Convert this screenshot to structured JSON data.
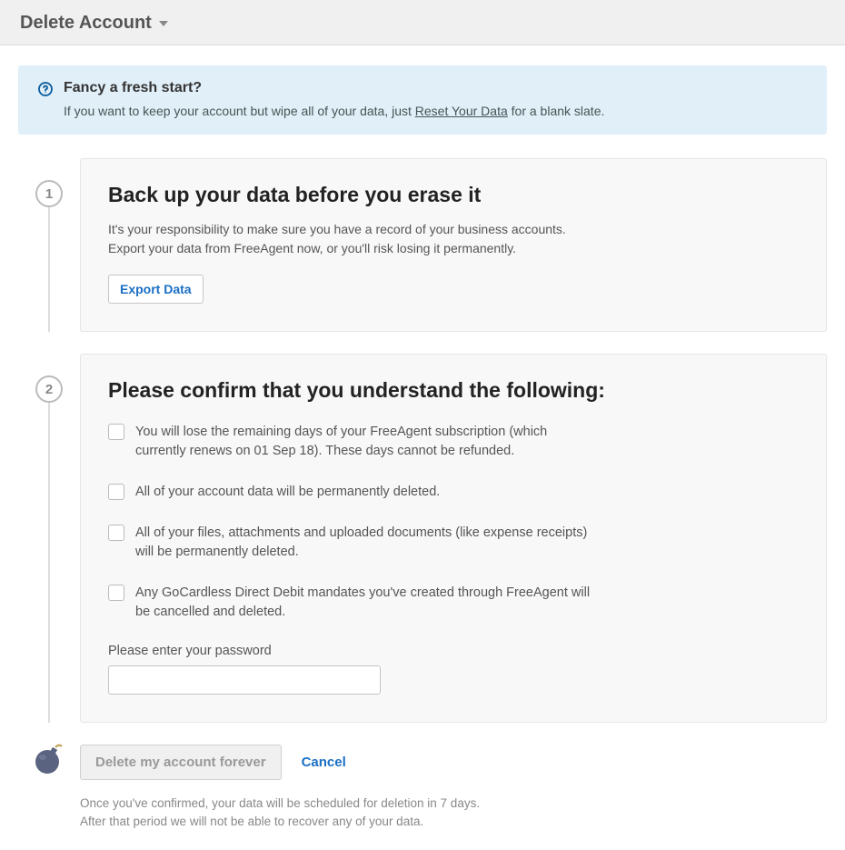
{
  "header": {
    "title": "Delete Account"
  },
  "banner": {
    "title": "Fancy a fresh start?",
    "text_before": "If you want to keep your account but wipe all of your data, just ",
    "link": "Reset Your Data",
    "text_after": " for a blank slate."
  },
  "step1": {
    "number": "1",
    "title": "Back up your data before you erase it",
    "subtitle_line1": "It's your responsibility to make sure you have a record of your business accounts.",
    "subtitle_line2": "Export your data from FreeAgent now, or you'll risk losing it permanently.",
    "button": "Export Data"
  },
  "step2": {
    "number": "2",
    "title": "Please confirm that you understand the following:",
    "items": [
      "You will lose the remaining days of your FreeAgent subscription (which currently renews on 01 Sep 18). These days cannot be refunded.",
      "All of your account data will be permanently deleted.",
      "All of your files, attachments and uploaded documents (like expense receipts) will be permanently deleted.",
      "Any GoCardless Direct Debit mandates you've created through FreeAgent will be cancelled and deleted."
    ],
    "password_label": "Please enter your password"
  },
  "actions": {
    "delete_label": "Delete my account forever",
    "cancel_label": "Cancel",
    "footnote_line1": "Once you've confirmed, your data will be scheduled for deletion in 7 days.",
    "footnote_line2": "After that period we will not be able to recover any of your data."
  }
}
